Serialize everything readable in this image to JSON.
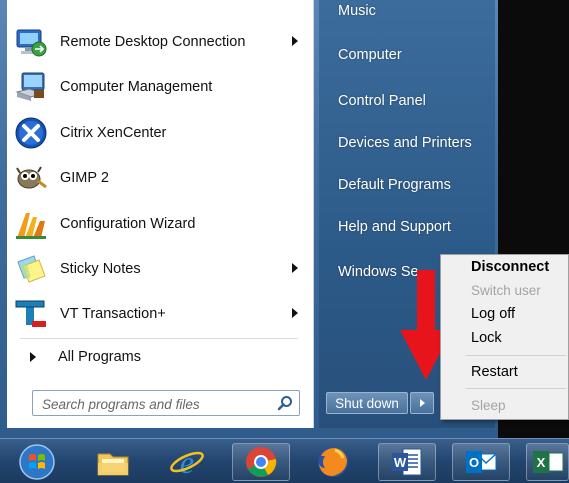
{
  "programs": [
    {
      "label": "Remote Desktop Connection",
      "icon": "remote-desktop-icon",
      "has_submenu": true
    },
    {
      "label": "Computer Management",
      "icon": "computer-management-icon",
      "has_submenu": false
    },
    {
      "label": "Citrix XenCenter",
      "icon": "citrix-icon",
      "has_submenu": false
    },
    {
      "label": "GIMP 2",
      "icon": "gimp-icon",
      "has_submenu": false
    },
    {
      "label": "Configuration Wizard",
      "icon": "config-wizard-icon",
      "has_submenu": false
    },
    {
      "label": "Sticky Notes",
      "icon": "sticky-notes-icon",
      "has_submenu": true
    },
    {
      "label": "VT Transaction+",
      "icon": "vt-transaction-icon",
      "has_submenu": true
    }
  ],
  "all_programs": "All Programs",
  "search": {
    "placeholder": "Search programs and files"
  },
  "right_pane": {
    "items": [
      "Music",
      "Computer",
      "Control Panel",
      "Devices and Printers",
      "Default Programs",
      "Help and Support",
      "Windows Se"
    ]
  },
  "shutdown": {
    "label": "Shut down"
  },
  "context_menu": {
    "items": [
      {
        "label": "Disconnect",
        "enabled": true
      },
      {
        "label": "Switch user",
        "enabled": false
      },
      {
        "label": "Log off",
        "enabled": true
      },
      {
        "label": "Lock",
        "enabled": true
      },
      {
        "label": "Restart",
        "enabled": true
      },
      {
        "label": "Sleep",
        "enabled": false
      }
    ]
  },
  "taskbar": {
    "items": [
      "start-orb-icon",
      "file-explorer-icon",
      "internet-explorer-icon",
      "chrome-icon",
      "firefox-icon",
      "word-icon",
      "outlook-icon",
      "excel-icon"
    ]
  },
  "colors": {
    "annotation_arrow": "#e8141b",
    "menu_bg": "#f0f0f0",
    "taskbar": "#22456f"
  }
}
